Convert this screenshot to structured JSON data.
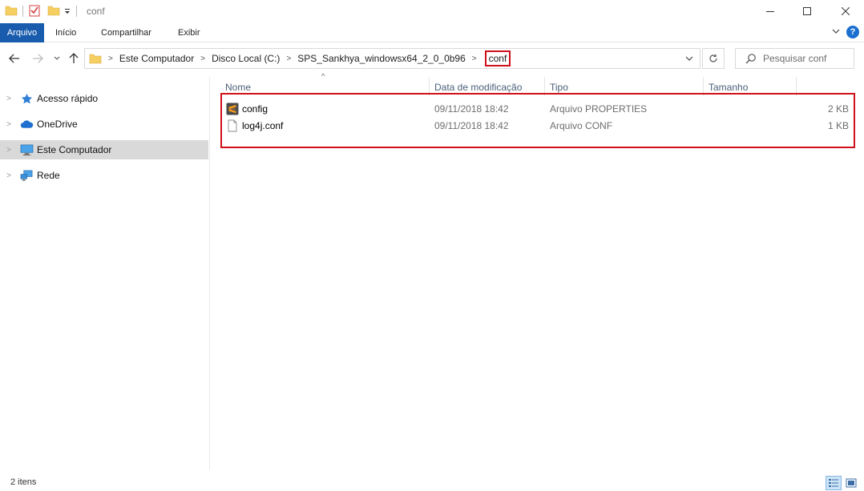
{
  "window": {
    "title": "conf",
    "minimize_icon": "minimize-icon",
    "maximize_icon": "maximize-icon",
    "close_icon": "close-icon"
  },
  "ribbon": {
    "tabs": [
      "Arquivo",
      "Início",
      "Compartilhar",
      "Exibir"
    ],
    "accent": "#195cae",
    "help": "?"
  },
  "address": {
    "breadcrumbs": [
      "Este Computador",
      "Disco Local (C:)",
      "SPS_Sankhya_windowsx64_2_0_0b96"
    ],
    "current": "conf",
    "search_placeholder": "Pesquisar conf",
    "highlight_color": "#d0101a"
  },
  "nav_pane": {
    "items": [
      {
        "label": "Acesso rápido",
        "icon": "star-icon",
        "selected": false
      },
      {
        "label": "OneDrive",
        "icon": "cloud-icon",
        "selected": false
      },
      {
        "label": "Este Computador",
        "icon": "computer-icon",
        "selected": true
      },
      {
        "label": "Rede",
        "icon": "network-icon",
        "selected": false
      }
    ]
  },
  "columns": {
    "name": "Nome",
    "date": "Data de modificação",
    "type": "Tipo",
    "size": "Tamanho"
  },
  "files": [
    {
      "name": "config",
      "date": "09/11/2018 18:42",
      "type": "Arquivo PROPERTIES",
      "size": "2 KB",
      "icon": "sublime-file-icon"
    },
    {
      "name": "log4j.conf",
      "date": "09/11/2018 18:42",
      "type": "Arquivo CONF",
      "size": "1 KB",
      "icon": "blank-file-icon"
    }
  ],
  "status": {
    "item_count": "2 itens"
  }
}
